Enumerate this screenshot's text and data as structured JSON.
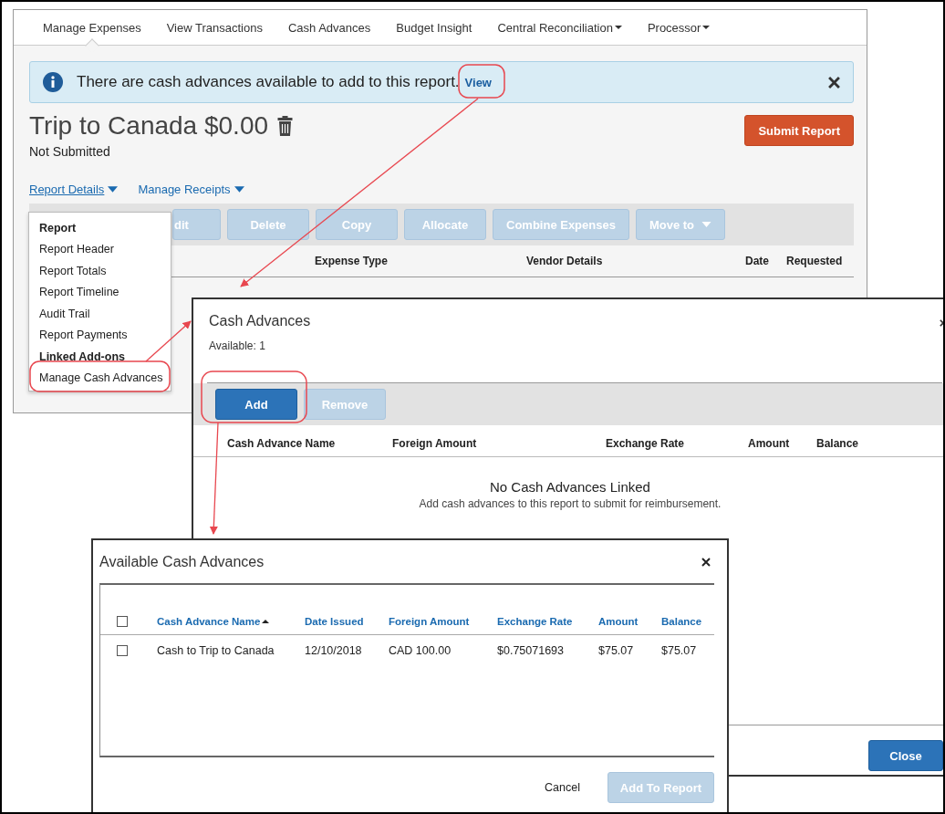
{
  "nav": {
    "tabs": [
      {
        "label": "Manage Expenses",
        "selected": true,
        "dropdown": false
      },
      {
        "label": "View Transactions",
        "selected": false,
        "dropdown": false
      },
      {
        "label": "Cash Advances",
        "selected": false,
        "dropdown": false
      },
      {
        "label": "Budget Insight",
        "selected": false,
        "dropdown": false
      },
      {
        "label": "Central Reconciliation",
        "selected": false,
        "dropdown": true
      },
      {
        "label": "Processor",
        "selected": false,
        "dropdown": true
      }
    ]
  },
  "banner": {
    "message": "There are cash advances available to add to this report.",
    "link": "View"
  },
  "report": {
    "title": "Trip to Canada $0.00",
    "status": "Not Submitted",
    "submit_button": "Submit Report"
  },
  "links": [
    {
      "label": "Report Details",
      "expanded": true
    },
    {
      "label": "Manage Receipts",
      "expanded": false
    }
  ],
  "toolbar": [
    {
      "label": "dit",
      "disabled": true
    },
    {
      "label": "Delete",
      "disabled": true
    },
    {
      "label": "Copy",
      "disabled": true
    },
    {
      "label": "Allocate",
      "disabled": true
    },
    {
      "label": "Combine Expenses",
      "disabled": true
    },
    {
      "label": "Move to",
      "disabled": true,
      "dropdown": true
    }
  ],
  "expense_columns": [
    "Expense Type",
    "Vendor Details",
    "Date",
    "Requested"
  ],
  "menu": [
    {
      "label": "Report",
      "kind": "heading"
    },
    {
      "label": "Report Header",
      "kind": "item"
    },
    {
      "label": "Report Totals",
      "kind": "item"
    },
    {
      "label": "Report Timeline",
      "kind": "item"
    },
    {
      "label": "Audit Trail",
      "kind": "item"
    },
    {
      "label": "Report Payments",
      "kind": "item"
    },
    {
      "label": "Linked Add-ons",
      "kind": "heading"
    },
    {
      "label": "Manage Cash Advances",
      "kind": "item"
    }
  ],
  "cash_advances_dialog": {
    "title": "Cash Advances",
    "available": "Available: 1",
    "buttons": [
      {
        "label": "Add",
        "disabled": false
      },
      {
        "label": "Remove",
        "disabled": true
      }
    ],
    "columns": [
      "Cash Advance Name",
      "Foreign Amount",
      "Exchange Rate",
      "Amount",
      "Balance"
    ],
    "empty_title": "No Cash Advances Linked",
    "empty_message": "Add cash advances to this report to submit for reimbursement.",
    "close_button": "Close"
  },
  "available_dialog": {
    "title": "Available Cash Advances",
    "select_all_checked": false,
    "columns": [
      {
        "label": "Cash Advance Name",
        "sorted": true
      },
      {
        "label": "Date Issued",
        "sorted": false
      },
      {
        "label": "Foreign Amount",
        "sorted": false
      },
      {
        "label": "Exchange Rate",
        "sorted": false
      },
      {
        "label": "Amount",
        "sorted": false
      },
      {
        "label": "Balance",
        "sorted": false
      }
    ],
    "rows": [
      {
        "checked": false,
        "cells": [
          "Cash to Trip to Canada",
          "12/10/2018",
          "CAD 100.00",
          "$0.75071693",
          "$75.07",
          "$75.07"
        ]
      }
    ],
    "cancel": "Cancel",
    "add_button": {
      "label": "Add To Report",
      "disabled": true
    }
  }
}
